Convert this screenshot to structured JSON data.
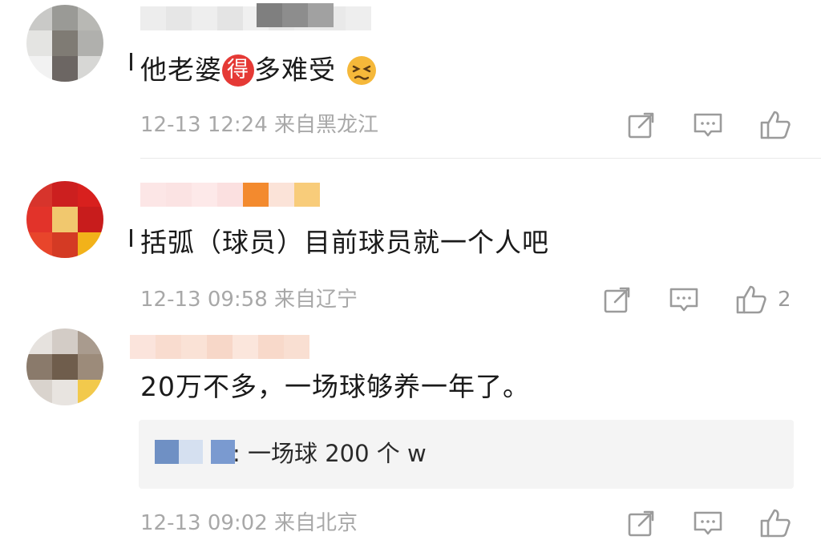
{
  "comments": [
    {
      "text_parts": [
        "他老婆",
        "得",
        "多难受"
      ],
      "emoji": "persevering-face-emoji",
      "meta": "12-13 12:24 来自黑龙江",
      "likes": ""
    },
    {
      "text": "括弧（球员）目前球员就一个人吧",
      "meta": "12-13 09:58 来自辽宁",
      "likes": "2"
    },
    {
      "text": "20万不多，一场球够养一年了。",
      "reply": {
        "text": ": 一场球 200 个 w"
      },
      "meta": "12-13 09:02 来自北京",
      "likes": ""
    }
  ],
  "icons": {
    "share": "share-icon",
    "comment": "comment-icon",
    "like": "thumbs-up-icon"
  },
  "colors": {
    "meta_gray": "#a8a8a8",
    "badge_red": "#e53935",
    "reply_bg": "#f4f4f4"
  }
}
